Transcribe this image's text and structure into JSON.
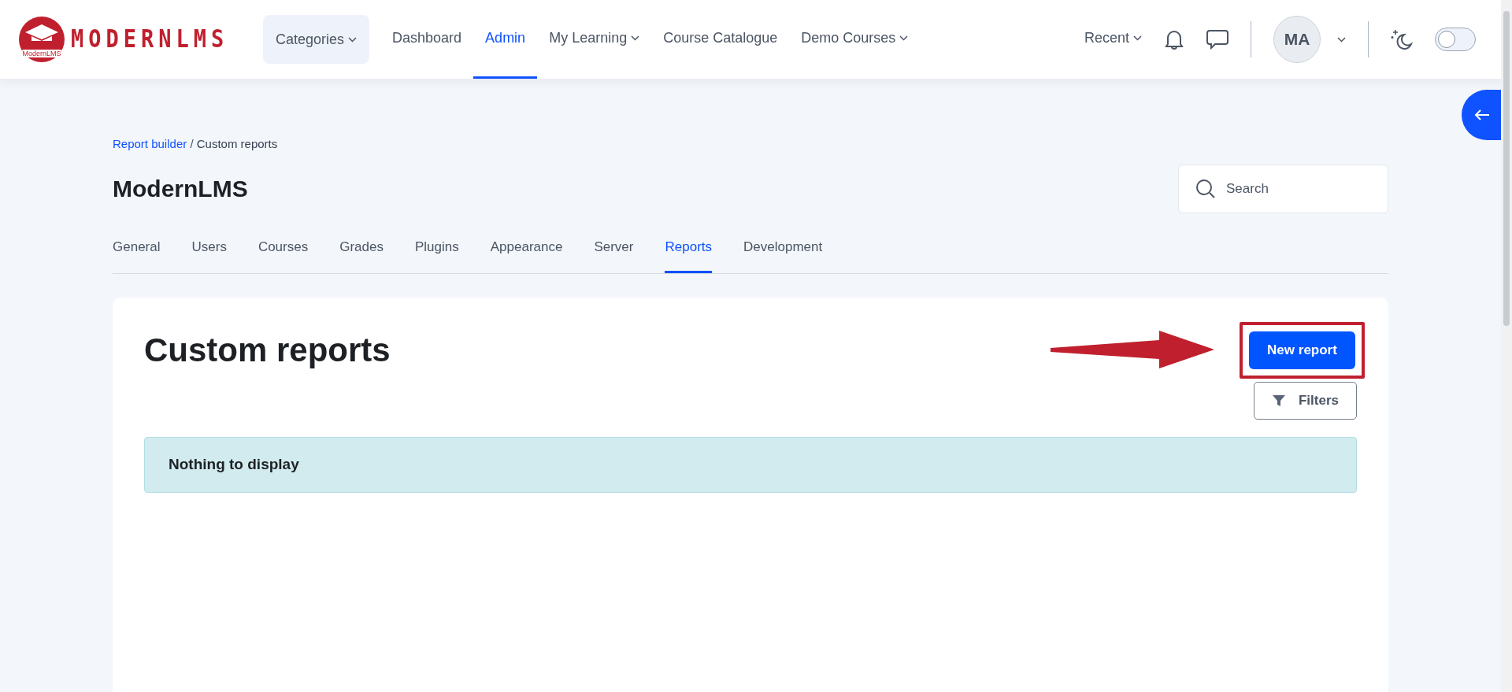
{
  "logo": {
    "wordmark": "MODERNLMS",
    "badge_text": "ModernLMS"
  },
  "nav": [
    {
      "label": "Categories",
      "kind": "dropdown-pill",
      "selected": false
    },
    {
      "label": "Dashboard",
      "kind": "link",
      "selected": false
    },
    {
      "label": "Admin",
      "kind": "link",
      "selected": true
    },
    {
      "label": "My Learning",
      "kind": "dropdown",
      "selected": false
    },
    {
      "label": "Course Catalogue",
      "kind": "link",
      "selected": false
    },
    {
      "label": "Demo Courses",
      "kind": "dropdown",
      "selected": false
    }
  ],
  "recent": {
    "label": "Recent"
  },
  "user": {
    "initials": "MA"
  },
  "dark_mode_switch": {
    "on": false
  },
  "breadcrumb": [
    {
      "label": "Report builder",
      "kind": "link"
    },
    {
      "label": "/",
      "kind": "separator"
    },
    {
      "label": "Custom reports",
      "kind": "current"
    }
  ],
  "site_title": "ModernLMS",
  "search": {
    "placeholder": "Search"
  },
  "tabs": [
    {
      "label": "General",
      "selected": false
    },
    {
      "label": "Users",
      "selected": false
    },
    {
      "label": "Courses",
      "selected": false
    },
    {
      "label": "Grades",
      "selected": false
    },
    {
      "label": "Plugins",
      "selected": false
    },
    {
      "label": "Appearance",
      "selected": false
    },
    {
      "label": "Server",
      "selected": false
    },
    {
      "label": "Reports",
      "selected": true
    },
    {
      "label": "Development",
      "selected": false
    }
  ],
  "page_heading": "Custom reports",
  "new_report_button": "New report",
  "filters_button": "Filters",
  "empty_message": "Nothing to display"
}
